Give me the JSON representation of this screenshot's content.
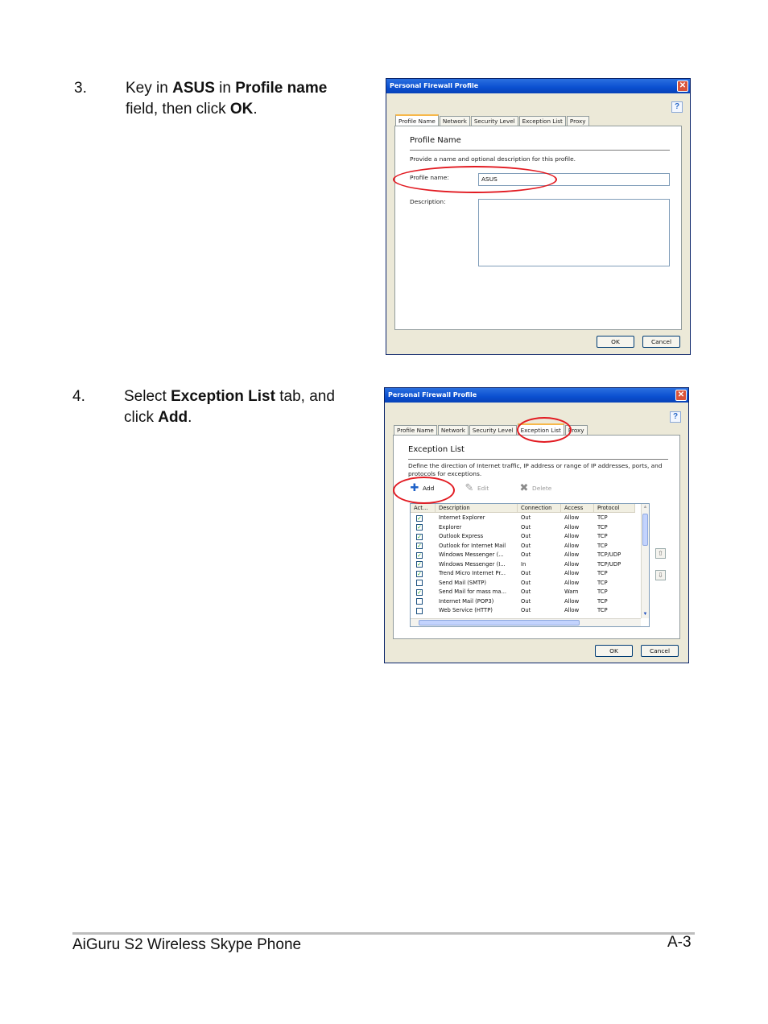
{
  "steps": [
    {
      "number": "3.",
      "parts": [
        {
          "t": "Key in ",
          "b": false
        },
        {
          "t": "ASUS",
          "b": true
        },
        {
          "t": " in ",
          "b": false
        },
        {
          "t": "Profile name",
          "b": true
        },
        {
          "t": "\nfield, then click ",
          "b": false
        },
        {
          "t": "OK",
          "b": true
        },
        {
          "t": ".",
          "b": false
        }
      ]
    },
    {
      "number": "4.",
      "parts": [
        {
          "t": "Select ",
          "b": false
        },
        {
          "t": "Exception List",
          "b": true
        },
        {
          "t": " tab, and\nclick ",
          "b": false
        },
        {
          "t": "Add",
          "b": true
        },
        {
          "t": ".",
          "b": false
        }
      ]
    }
  ],
  "dialog1": {
    "title": "Personal Firewall Profile",
    "close": "✕",
    "help_glyph": "?",
    "tabs": [
      "Profile Name",
      "Network",
      "Security Level",
      "Exception List",
      "Proxy"
    ],
    "active_tab": 0,
    "heading": "Profile Name",
    "instructions": "Provide a name and optional description for this profile.",
    "profile_name_label": "Profile name:",
    "profile_name_value": "ASUS",
    "description_label": "Description:",
    "description_value": "",
    "ok": "OK",
    "cancel": "Cancel"
  },
  "dialog2": {
    "title": "Personal Firewall Profile",
    "close": "✕",
    "help_glyph": "?",
    "tabs": [
      "Profile Name",
      "Network",
      "Security Level",
      "Exception List",
      "Proxy"
    ],
    "active_tab": 3,
    "heading": "Exception List",
    "instructions": "Define the direction of Internet traffic, IP address or range of IP addresses, ports, and protocols for exceptions.",
    "toolbar": {
      "add": "Add",
      "edit": "Edit",
      "delete": "Delete"
    },
    "columns": [
      "Act...",
      "Description",
      "Connection",
      "Access",
      "Protocol"
    ],
    "rows": [
      {
        "checked": true,
        "description": "Internet Explorer",
        "connection": "Out",
        "access": "Allow",
        "protocol": "TCP"
      },
      {
        "checked": true,
        "description": "Explorer",
        "connection": "Out",
        "access": "Allow",
        "protocol": "TCP"
      },
      {
        "checked": true,
        "description": "Outlook Express",
        "connection": "Out",
        "access": "Allow",
        "protocol": "TCP"
      },
      {
        "checked": true,
        "description": "Outlook for Internet Mail",
        "connection": "Out",
        "access": "Allow",
        "protocol": "TCP"
      },
      {
        "checked": true,
        "description": "Windows Messenger (...",
        "connection": "Out",
        "access": "Allow",
        "protocol": "TCP/UDP"
      },
      {
        "checked": true,
        "description": "Windows Messenger (I...",
        "connection": "In",
        "access": "Allow",
        "protocol": "TCP/UDP"
      },
      {
        "checked": true,
        "description": "Trend Micro Internet Pr...",
        "connection": "Out",
        "access": "Allow",
        "protocol": "TCP"
      },
      {
        "checked": false,
        "description": "Send Mail (SMTP)",
        "connection": "Out",
        "access": "Allow",
        "protocol": "TCP"
      },
      {
        "checked": true,
        "description": "Send Mail for mass ma...",
        "connection": "Out",
        "access": "Warn",
        "protocol": "TCP"
      },
      {
        "checked": false,
        "description": "Internet Mail (POP3)",
        "connection": "Out",
        "access": "Allow",
        "protocol": "TCP"
      },
      {
        "checked": false,
        "description": "Web Service (HTTP)",
        "connection": "Out",
        "access": "Allow",
        "protocol": "TCP"
      }
    ],
    "ok": "OK",
    "cancel": "Cancel"
  },
  "footer": {
    "left": "AiGuru S2 Wireless Skype Phone",
    "right": "A-3"
  }
}
